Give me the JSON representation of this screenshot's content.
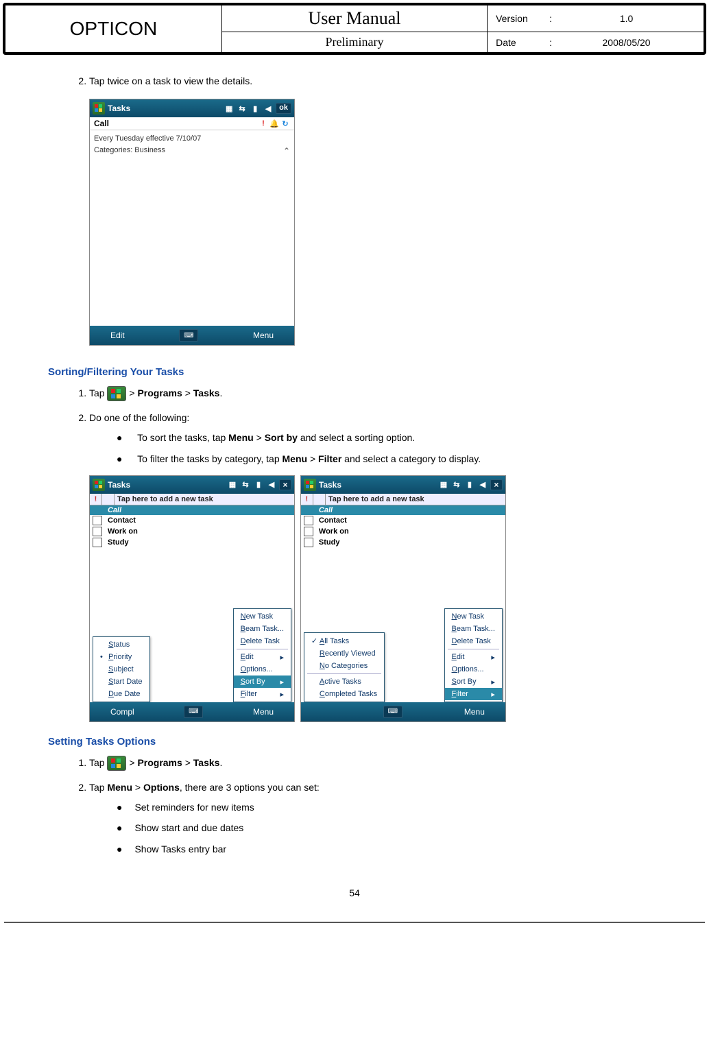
{
  "header": {
    "brand": "OPTICON",
    "title": "User Manual",
    "subtitle": "Preliminary",
    "version_label": "Version",
    "version": "1.0",
    "date_label": "Date",
    "date": "2008/05/20"
  },
  "step2_intro": "Tap twice on a task to view the details.",
  "shot1": {
    "title": "Tasks",
    "ok": "ok",
    "task_name": "Call",
    "line1": "Every Tuesday effective 7/10/07",
    "line2": "Categories:  Business",
    "soft_left": "Edit",
    "soft_right": "Menu"
  },
  "section_sort": {
    "title": "Sorting/Filtering Your Tasks",
    "step1_pre": "Tap ",
    "step1_path_programs": "Programs",
    "step1_path_tasks": "Tasks",
    "step2": "Do one of the following:",
    "bullet1_pre": "To sort the tasks, tap ",
    "bullet1_menu": "Menu",
    "bullet1_sortby": "Sort by",
    "bullet1_post": " and select a sorting option.",
    "bullet2_pre": "To filter the tasks by category, tap ",
    "bullet2_menu": "Menu",
    "bullet2_filter": "Filter",
    "bullet2_post": " and select a category to display."
  },
  "shot2": {
    "title": "Tasks",
    "entry_label": "Tap here to add a new task",
    "bang": "!",
    "rows": [
      "Call",
      "Contact",
      "Work on",
      "Study"
    ],
    "soft_left": "Compl",
    "soft_right": "Menu",
    "menu_main": [
      {
        "t": "New Task",
        "u": "N"
      },
      {
        "t": "Beam Task...",
        "u": "B"
      },
      {
        "t": "Delete Task",
        "u": "D"
      },
      {
        "sep": true
      },
      {
        "t": "Edit",
        "u": "E",
        "arrow": true
      },
      {
        "t": "Options...",
        "u": "O"
      },
      {
        "t": "Sort By",
        "u": "S",
        "arrow": true,
        "sel": true
      },
      {
        "t": "Filter",
        "u": "F",
        "arrow": true
      }
    ],
    "menu_sub": [
      {
        "t": "Status",
        "u": "S"
      },
      {
        "t": "Priority",
        "u": "P",
        "dot": true
      },
      {
        "t": "Subject",
        "u": "S"
      },
      {
        "t": "Start Date",
        "u": "S"
      },
      {
        "t": "Due Date",
        "u": "D"
      }
    ]
  },
  "shot3": {
    "title": "Tasks",
    "entry_label": "Tap here to add a new task",
    "bang": "!",
    "rows": [
      "Call",
      "Contact",
      "Work on",
      "Study"
    ],
    "soft_left": "",
    "soft_right": "Menu",
    "menu_main": [
      {
        "t": "New Task",
        "u": "N"
      },
      {
        "t": "Beam Task...",
        "u": "B"
      },
      {
        "t": "Delete Task",
        "u": "D"
      },
      {
        "sep": true
      },
      {
        "t": "Edit",
        "u": "E",
        "arrow": true
      },
      {
        "t": "Options...",
        "u": "O"
      },
      {
        "t": "Sort By",
        "u": "S",
        "arrow": true
      },
      {
        "t": "Filter",
        "u": "F",
        "arrow": true,
        "sel": true
      }
    ],
    "menu_sub": [
      {
        "t": "All Tasks",
        "u": "A",
        "chk": true
      },
      {
        "t": "Recently Viewed",
        "u": "R"
      },
      {
        "t": "No Categories",
        "u": "N"
      },
      {
        "sep": true
      },
      {
        "t": "Active Tasks",
        "u": "A"
      },
      {
        "t": "Completed Tasks",
        "u": "C"
      }
    ]
  },
  "section_options": {
    "title": "Setting Tasks Options",
    "step1_pre": "Tap ",
    "step1_path_programs": "Programs",
    "step1_path_tasks": "Tasks",
    "step2_pre": "Tap ",
    "step2_menu": "Menu",
    "step2_options": "Options",
    "step2_post": ", there are 3 options you can set:",
    "bullets": [
      "Set reminders for new items",
      "Show start and due dates",
      "Show Tasks entry bar"
    ]
  },
  "page_number": "54",
  "gt": " > ",
  "period": "."
}
